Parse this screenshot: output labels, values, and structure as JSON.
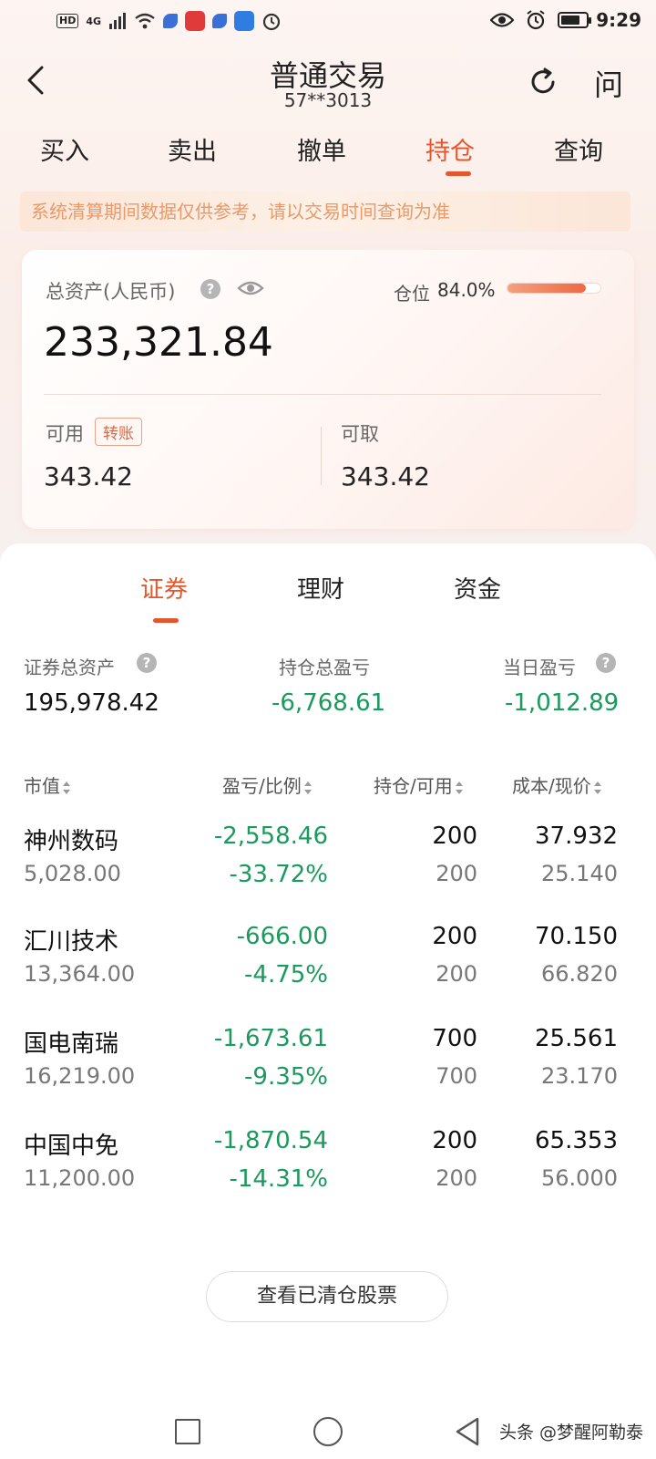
{
  "status_bar": {
    "hd": "HD",
    "signal": "4G",
    "time": "9:29",
    "battery_level": 0.75
  },
  "header": {
    "title": "普通交易",
    "account": "57**3013",
    "ask_label": "问"
  },
  "tabs": [
    {
      "label": "买入"
    },
    {
      "label": "卖出"
    },
    {
      "label": "撤单"
    },
    {
      "label": "持仓",
      "active": true
    },
    {
      "label": "查询"
    }
  ],
  "notice": "系统清算期间数据仅供参考，请以交易时间查询为准",
  "assets": {
    "total_label": "总资产(人民币)",
    "total_value": "233,321.84",
    "position_label": "仓位",
    "position_value": "84.0%",
    "position_ratio": 0.84,
    "available_label": "可用",
    "transfer_label": "转账",
    "available_value": "343.42",
    "withdrawable_label": "可取",
    "withdrawable_value": "343.42"
  },
  "sub_tabs": [
    {
      "label": "证券",
      "active": true
    },
    {
      "label": "理财"
    },
    {
      "label": "资金"
    }
  ],
  "summary": {
    "securities_total_label": "证券总资产",
    "securities_total_value": "195,978.42",
    "holding_pnl_label": "持仓总盈亏",
    "holding_pnl_value": "-6,768.61",
    "daily_pnl_label": "当日盈亏",
    "daily_pnl_value": "-1,012.89"
  },
  "columns": {
    "market_value": "市值",
    "pnl_ratio": "盈亏/比例",
    "holding_available": "持仓/可用",
    "cost_price": "成本/现价"
  },
  "holdings": [
    {
      "name": "神州数码",
      "market_value": "5,028.00",
      "pnl": "-2,558.46",
      "ratio": "-33.72%",
      "holding": "200",
      "available": "200",
      "cost": "37.932",
      "price": "25.140"
    },
    {
      "name": "汇川技术",
      "market_value": "13,364.00",
      "pnl": "-666.00",
      "ratio": "-4.75%",
      "holding": "200",
      "available": "200",
      "cost": "70.150",
      "price": "66.820"
    },
    {
      "name": "国电南瑞",
      "market_value": "16,219.00",
      "pnl": "-1,673.61",
      "ratio": "-9.35%",
      "holding": "700",
      "available": "700",
      "cost": "25.561",
      "price": "23.170"
    },
    {
      "name": "中国中免",
      "market_value": "11,200.00",
      "pnl": "-1,870.54",
      "ratio": "-14.31%",
      "holding": "200",
      "available": "200",
      "cost": "65.353",
      "price": "56.000"
    }
  ],
  "cleared_button": "查看已清仓股票",
  "watermark": "头条 @梦醒阿勒泰",
  "colors": {
    "accent": "#e4572e",
    "loss_green": "#1a9a5c"
  }
}
